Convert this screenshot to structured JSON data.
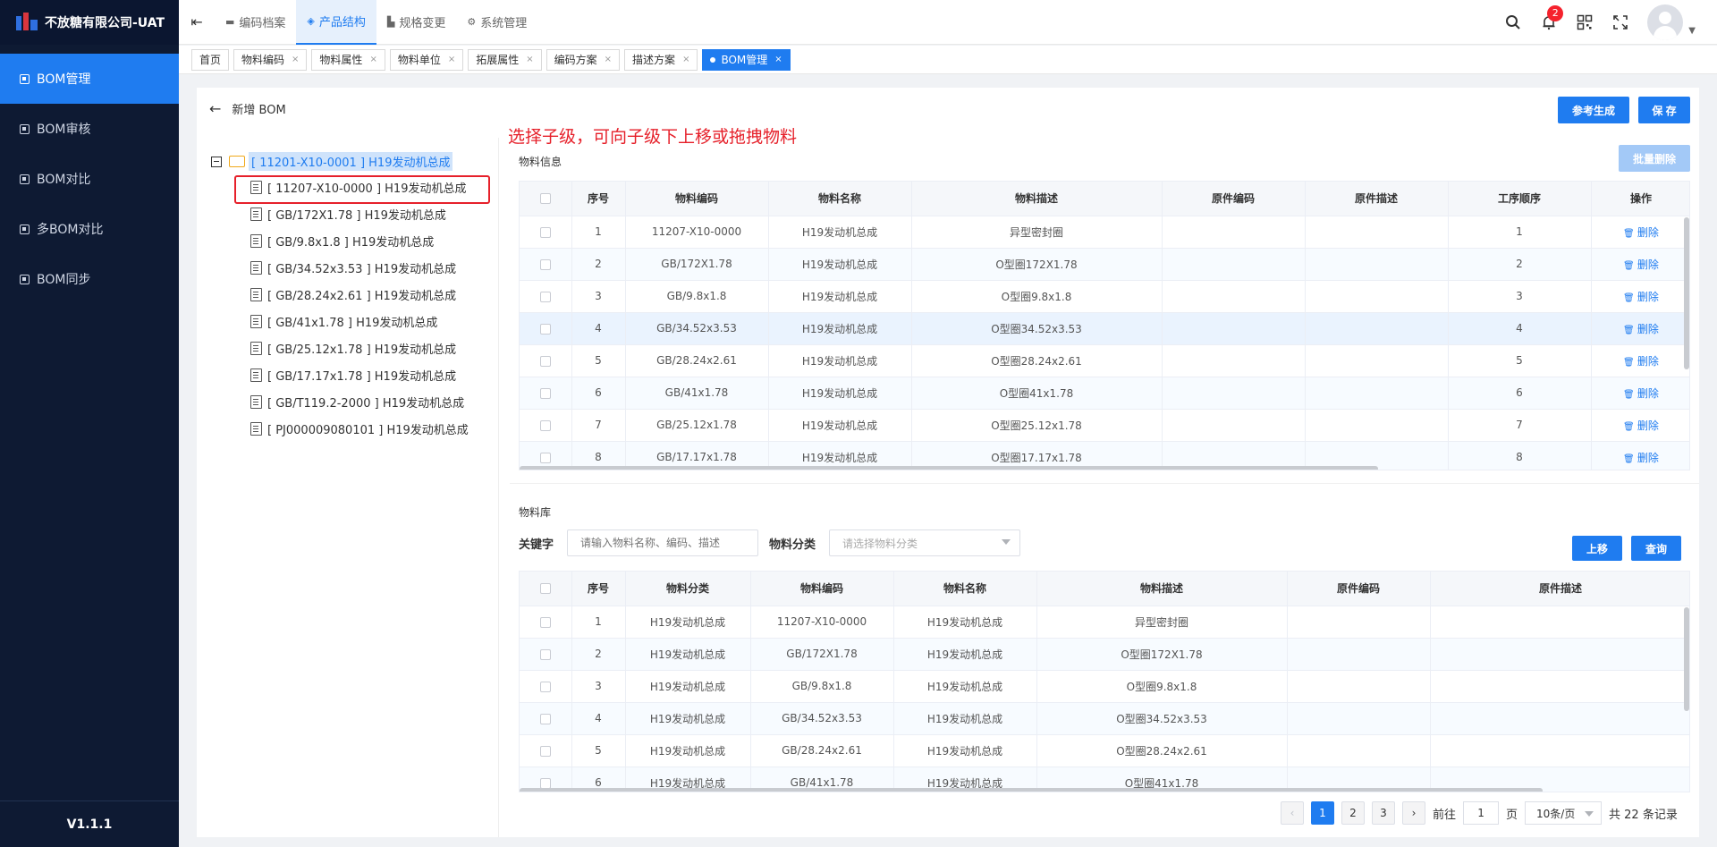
{
  "app": {
    "brand": "不放糖有限公司-UAT",
    "version": "V1.1.1"
  },
  "sidebar": {
    "items": [
      {
        "label": "BOM管理",
        "active": true
      },
      {
        "label": "BOM审核"
      },
      {
        "label": "BOM对比"
      },
      {
        "label": "多BOM对比"
      },
      {
        "label": "BOM同步"
      }
    ]
  },
  "topnav": {
    "items": [
      {
        "label": "编码档案",
        "icon": "folder-icon"
      },
      {
        "label": "产品结构",
        "icon": "layers-icon",
        "active": true
      },
      {
        "label": "规格变更",
        "icon": "chart-icon"
      },
      {
        "label": "系统管理",
        "icon": "gear-icon"
      }
    ]
  },
  "header": {
    "notification_count": "2"
  },
  "tabs": [
    {
      "label": "首页"
    },
    {
      "label": "物料编码",
      "close": "×"
    },
    {
      "label": "物料属性",
      "close": "×"
    },
    {
      "label": "物料单位",
      "close": "×"
    },
    {
      "label": "拓展属性",
      "close": "×"
    },
    {
      "label": "编码方案",
      "close": "×"
    },
    {
      "label": "描述方案",
      "close": "×"
    },
    {
      "label": "BOM管理",
      "close": "×",
      "active": true
    }
  ],
  "page": {
    "back_arrow": "←",
    "title": "新增 BOM",
    "ref_generate": "参考生成",
    "save": "保 存",
    "annotation": "选择子级，可向子级下上移或拖拽物料"
  },
  "tree": {
    "root": "[ 11201-X10-0001 ] H19发动机总成",
    "children": [
      "[ 11207-X10-0000 ] H19发动机总成",
      "[ GB/172X1.78 ] H19发动机总成",
      "[ GB/9.8x1.8 ] H19发动机总成",
      "[ GB/34.52x3.53 ] H19发动机总成",
      "[ GB/28.24x2.61 ] H19发动机总成",
      "[ GB/41x1.78 ] H19发动机总成",
      "[ GB/25.12x1.78 ] H19发动机总成",
      "[ GB/17.17x1.78 ] H19发动机总成",
      "[ GB/T119.2-2000 ] H19发动机总成",
      "[ PJ000009080101 ] H19发动机总成"
    ]
  },
  "material_info": {
    "title": "物料信息",
    "batch_delete": "批量删除",
    "columns": [
      "序号",
      "物料编码",
      "物料名称",
      "物料描述",
      "原件编码",
      "原件描述",
      "工序顺序",
      "操作"
    ],
    "delete_label": "删除",
    "rows": [
      {
        "no": "1",
        "code": "11207-X10-0000",
        "name": "H19发动机总成",
        "desc": "异型密封圈",
        "order": "1"
      },
      {
        "no": "2",
        "code": "GB/172X1.78",
        "name": "H19发动机总成",
        "desc": "O型圈172X1.78",
        "order": "2"
      },
      {
        "no": "3",
        "code": "GB/9.8x1.8",
        "name": "H19发动机总成",
        "desc": "O型圈9.8x1.8",
        "order": "3"
      },
      {
        "no": "4",
        "code": "GB/34.52x3.53",
        "name": "H19发动机总成",
        "desc": "O型圈34.52x3.53",
        "order": "4"
      },
      {
        "no": "5",
        "code": "GB/28.24x2.61",
        "name": "H19发动机总成",
        "desc": "O型圈28.24x2.61",
        "order": "5"
      },
      {
        "no": "6",
        "code": "GB/41x1.78",
        "name": "H19发动机总成",
        "desc": "O型圈41x1.78",
        "order": "6"
      },
      {
        "no": "7",
        "code": "GB/25.12x1.78",
        "name": "H19发动机总成",
        "desc": "O型圈25.12x1.78",
        "order": "7"
      },
      {
        "no": "8",
        "code": "GB/17.17x1.78",
        "name": "H19发动机总成",
        "desc": "O型圈17.17x1.78",
        "order": "8"
      }
    ]
  },
  "library": {
    "title": "物料库",
    "keyword_label": "关键字",
    "keyword_placeholder": "请输入物料名称、编码、描述",
    "category_label": "物料分类",
    "category_placeholder": "请选择物料分类",
    "move_up": "上移",
    "query": "查询",
    "columns": [
      "序号",
      "物料分类",
      "物料编码",
      "物料名称",
      "物料描述",
      "原件编码",
      "原件描述"
    ],
    "rows": [
      {
        "no": "1",
        "category": "H19发动机总成",
        "code": "11207-X10-0000",
        "name": "H19发动机总成",
        "desc": "异型密封圈"
      },
      {
        "no": "2",
        "category": "H19发动机总成",
        "code": "GB/172X1.78",
        "name": "H19发动机总成",
        "desc": "O型圈172X1.78"
      },
      {
        "no": "3",
        "category": "H19发动机总成",
        "code": "GB/9.8x1.8",
        "name": "H19发动机总成",
        "desc": "O型圈9.8x1.8"
      },
      {
        "no": "4",
        "category": "H19发动机总成",
        "code": "GB/34.52x3.53",
        "name": "H19发动机总成",
        "desc": "O型圈34.52x3.53"
      },
      {
        "no": "5",
        "category": "H19发动机总成",
        "code": "GB/28.24x2.61",
        "name": "H19发动机总成",
        "desc": "O型圈28.24x2.61"
      },
      {
        "no": "6",
        "category": "H19发动机总成",
        "code": "GB/41x1.78",
        "name": "H19发动机总成",
        "desc": "O型圈41x1.78"
      }
    ]
  },
  "pagination": {
    "prev": "‹",
    "next": "›",
    "pages": [
      "1",
      "2",
      "3"
    ],
    "current": "1",
    "goto_prefix": "前往",
    "goto_value": "1",
    "goto_suffix": "页",
    "page_size": "10条/页",
    "total": "共 22 条记录"
  },
  "colors": {
    "primary": "#1f7cf0",
    "sidebar": "#0e1a33",
    "annotation": "#e6202a"
  }
}
